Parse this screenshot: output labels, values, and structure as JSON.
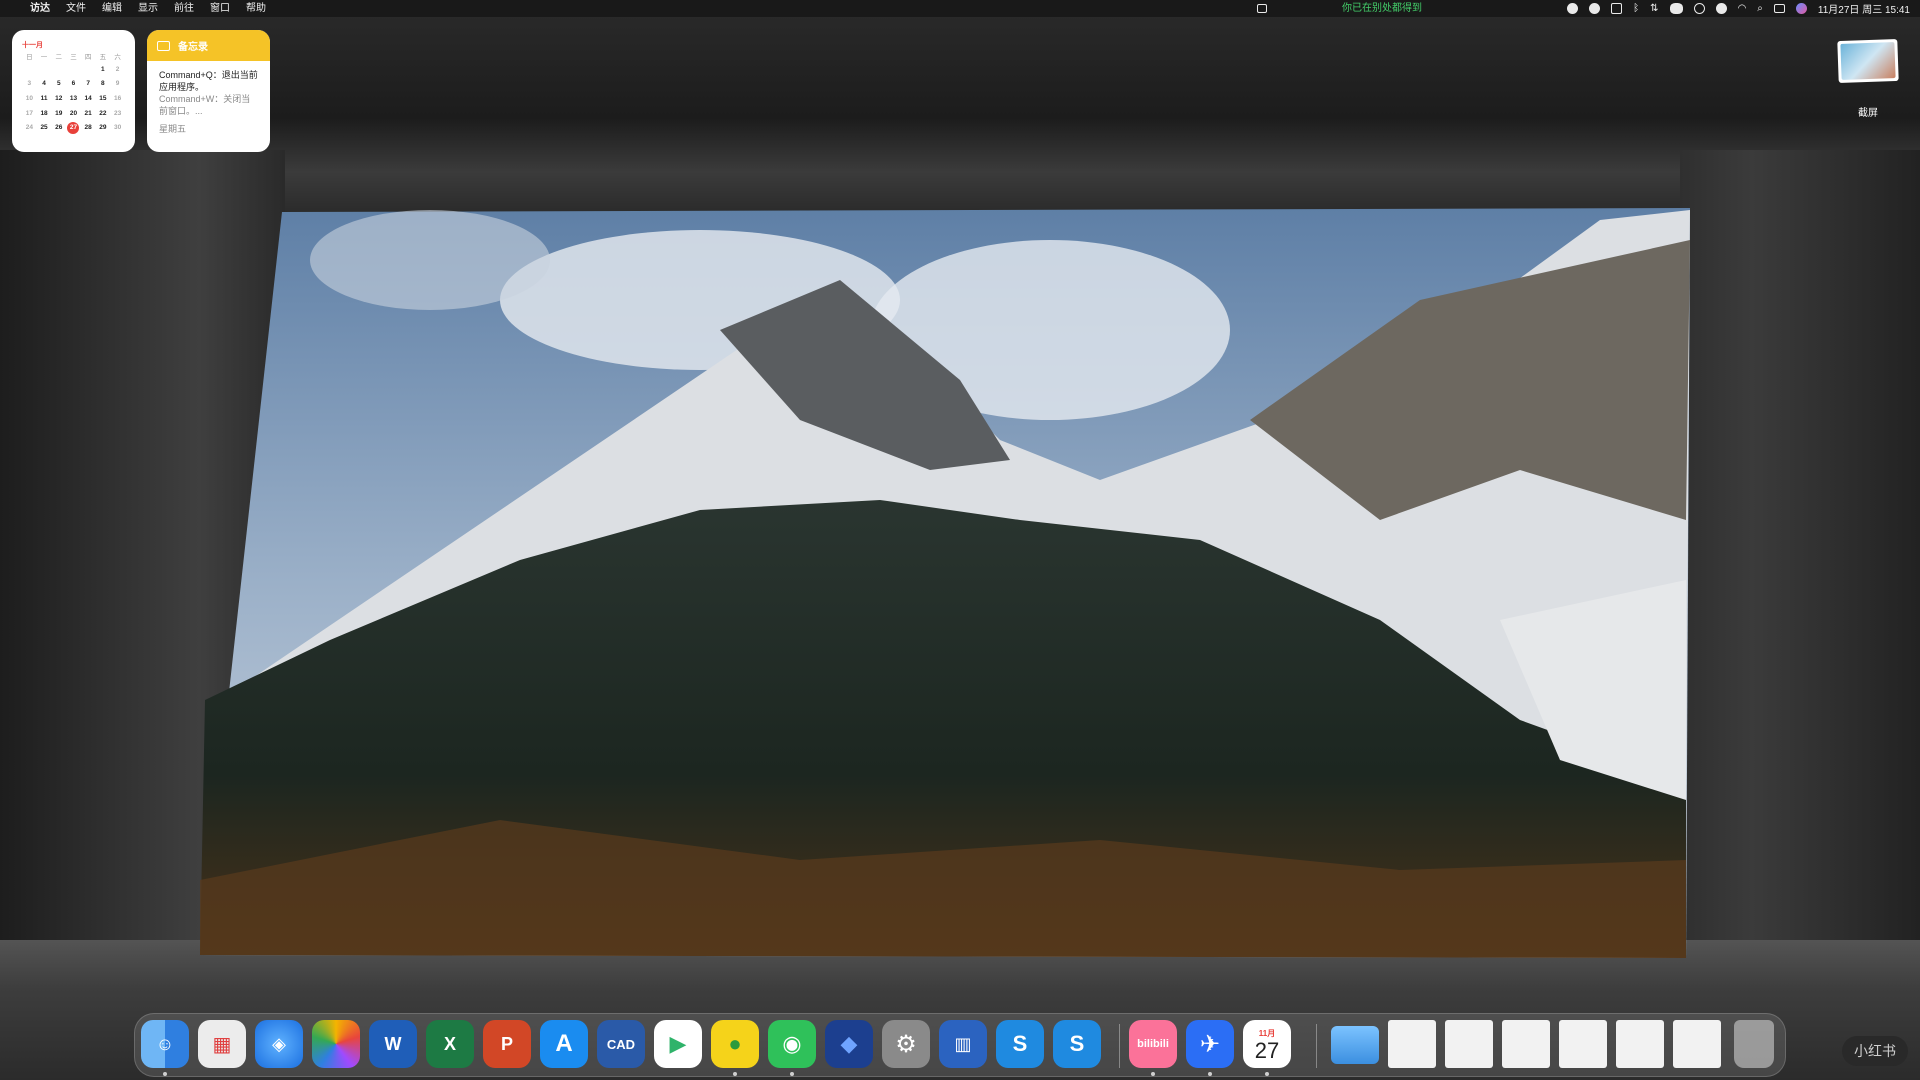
{
  "menubar": {
    "apple_glyph": "",
    "app_name": "访达",
    "items": [
      "文件",
      "编辑",
      "显示",
      "前往",
      "窗口",
      "帮助"
    ],
    "notice": "你已在别处都得到",
    "datetime": "11月27日 周三 15:41"
  },
  "calendar_widget": {
    "month": "十一月",
    "weekdays": [
      "日",
      "一",
      "二",
      "三",
      "四",
      "五",
      "六"
    ],
    "weeks": [
      [
        "",
        "",
        "",
        "",
        "",
        "1",
        "2"
      ],
      [
        "3",
        "4",
        "5",
        "6",
        "7",
        "8",
        "9"
      ],
      [
        "10",
        "11",
        "12",
        "13",
        "14",
        "15",
        "16"
      ],
      [
        "17",
        "18",
        "19",
        "20",
        "21",
        "22",
        "23"
      ],
      [
        "24",
        "25",
        "26",
        "27",
        "28",
        "29",
        "30"
      ]
    ],
    "today": "27"
  },
  "notes_widget": {
    "header": "备忘录",
    "line1": "Command+Q：退出当前应用程序。",
    "line2": "Command+W：关闭当前窗口。...",
    "date": "星期五"
  },
  "desktop": {
    "screenshot_label": "截屏"
  },
  "dock": {
    "calendar_month": "11月",
    "calendar_day": "27",
    "items": [
      "finder-icon",
      "launchpad-icon",
      "safari-icon",
      "photos-icon",
      "word-icon",
      "excel-icon",
      "powerpoint-icon",
      "app-store-icon",
      "cad-icon",
      "infuse-icon",
      "app-icon",
      "wechat-icon",
      "stack-icon",
      "settings-icon",
      "network-icon",
      "s-app-icon",
      "s-app-icon-2",
      "bilibili-icon",
      "feishu-icon",
      "calendar-icon",
      "folder-icon",
      "doc-thumb-icon",
      "doc-thumb-icon",
      "doc-thumb-icon",
      "doc-thumb-icon",
      "doc-thumb-icon",
      "doc-thumb-icon",
      "trash-icon"
    ],
    "bilibili_label": "bilibili",
    "cad_label": "CAD"
  },
  "watermark": "小红书"
}
